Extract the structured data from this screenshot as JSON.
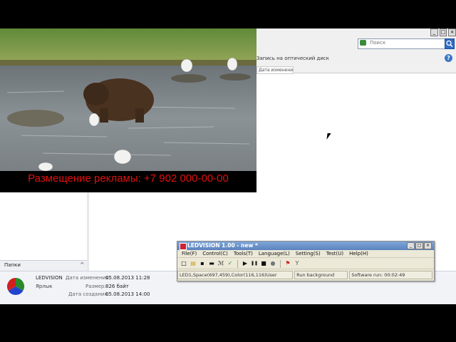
{
  "video": {
    "caption": "Размещение рекламы: +7 902 000-00-00"
  },
  "explorer": {
    "search_placeholder": "Поиск",
    "burn_label": "Запись на оптический диск",
    "column_header": "Дата изменения",
    "help_icon": "help-icon",
    "window_controls": [
      "_",
      "□",
      "×"
    ]
  },
  "folders": {
    "label": "Папки",
    "chevron": "^"
  },
  "details": {
    "file_name": "LEDVISION",
    "file_type": "Ярлык",
    "modified_label": "Дата изменения:",
    "modified_value": "05.08.2013 11:28",
    "size_label": "Размер:",
    "size_value": "826 байт",
    "created_label": "Дата создания:",
    "created_value": "05.08.2013 14:00"
  },
  "ledvision": {
    "title": "LEDVISION 1.00 - new *",
    "window_controls": [
      "_",
      "□",
      "×"
    ],
    "menu": [
      {
        "label": "File(F)"
      },
      {
        "label": "Control(C)"
      },
      {
        "label": "Tools(T)"
      },
      {
        "label": "Language(L)"
      },
      {
        "label": "Setting(S)"
      },
      {
        "label": "Test(U)"
      },
      {
        "label": "Help(H)"
      }
    ],
    "toolbar": {
      "new": "□",
      "open": "▤",
      "save": "▪",
      "screen": "▬",
      "mark": "ℳ",
      "check": "✓",
      "play": "▶",
      "pause": "❚❚",
      "stop": "■",
      "record": "●",
      "flag": "⚑",
      "y": "Y"
    },
    "status": [
      "LED1,Space(697,459),Color(116,116)User",
      "Run background",
      "Software run: 00:02:49"
    ]
  },
  "colors": {
    "caption": "#e21010",
    "titlebar": "#5b83be",
    "background": "#000000"
  }
}
